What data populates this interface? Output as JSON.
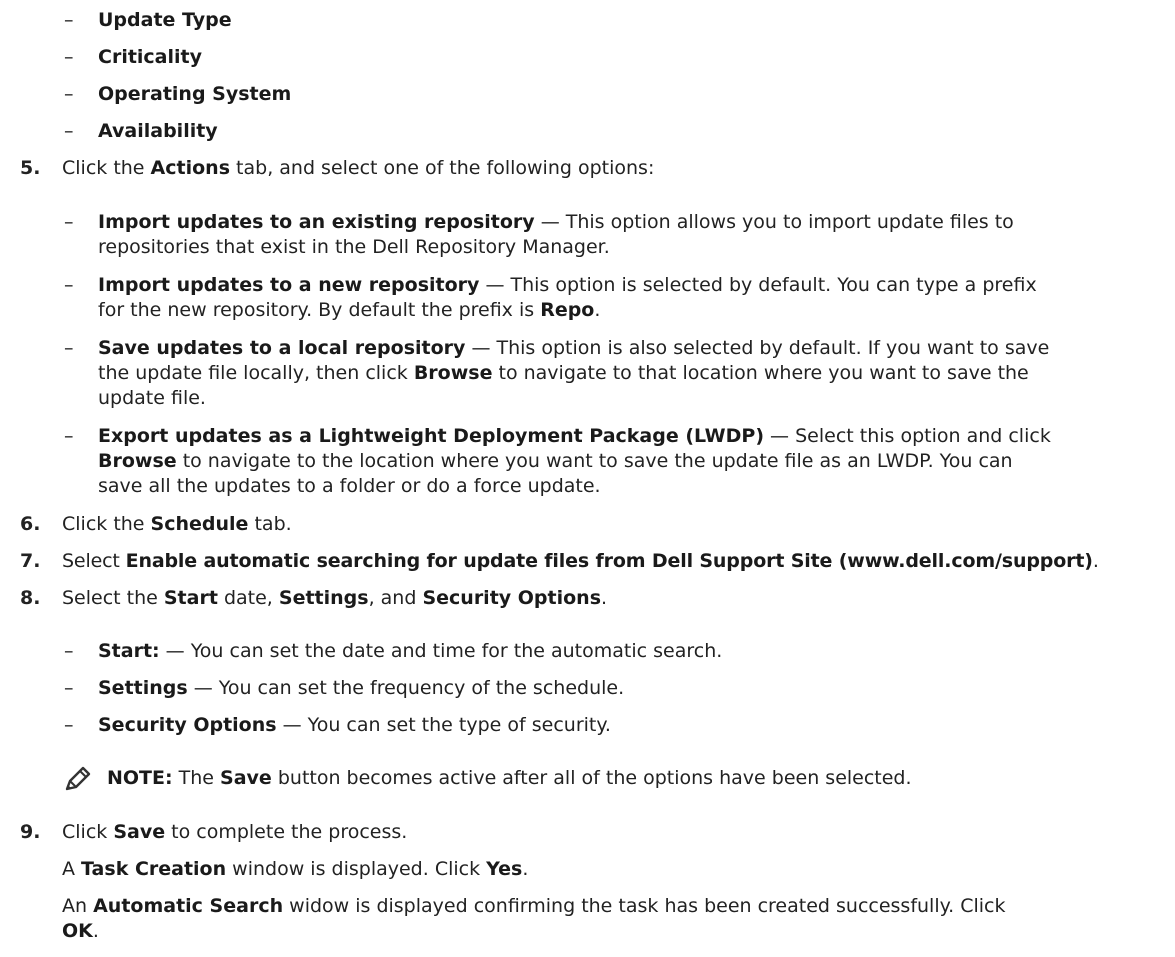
{
  "bullets_top": [
    {
      "dash": "–",
      "label": "Update Type"
    },
    {
      "dash": "–",
      "label": "Criticality"
    },
    {
      "dash": "–",
      "label": "Operating System"
    },
    {
      "dash": "–",
      "label": "Availability"
    }
  ],
  "step5": {
    "num": "5.",
    "pre": "Click the ",
    "bold": "Actions",
    "post": " tab, and select one of the following options:"
  },
  "actions": [
    {
      "dash": "–",
      "bold": "Import updates to an existing repository",
      "lines": [
        " — This option allows you to import update files to",
        "repositories that exist in the Dell Repository Manager."
      ]
    },
    {
      "dash": "–",
      "bold": "Import updates to a new repository",
      "line1": " — This option is selected by default. You can type a prefix",
      "line2_pre": "for the new repository. By default the prefix is ",
      "line2_bold": "Repo",
      "line2_post": "."
    },
    {
      "dash": "–",
      "bold": "Save updates to a local repository",
      "line1": " — This option is also selected by default. If you want to save",
      "line2_pre": "the update file locally, then click ",
      "line2_bold": "Browse",
      "line2_post": " to navigate to that location where you want to save the",
      "line3": "update file."
    },
    {
      "dash": "–",
      "bold": "Export updates as a Lightweight Deployment Package (LWDP)",
      "line1": " — Select this option and click",
      "line2_bold": "Browse",
      "line2_post": " to navigate to the location where you want to save the update file as an LWDP. You can",
      "line3": "save all the updates to a folder or do a force update."
    }
  ],
  "step6": {
    "num": "6.",
    "pre": "Click the ",
    "bold": "Schedule",
    "post": " tab."
  },
  "step7": {
    "num": "7.",
    "pre": "Select ",
    "bold": "Enable automatic searching for update files from Dell Support Site (www.dell.com/support)",
    "post": "."
  },
  "step8": {
    "num": "8.",
    "pre": "Select the ",
    "b1": "Start",
    "m1": " date, ",
    "b2": "Settings",
    "m2": ", and ",
    "b3": "Security Options",
    "post": "."
  },
  "schedule_opts": [
    {
      "dash": "–",
      "bold": "Start:",
      "text": " — You can set the date and time for the automatic search."
    },
    {
      "dash": "–",
      "bold": "Settings",
      "text": " — You can set the frequency of the schedule."
    },
    {
      "dash": "–",
      "bold": "Security Options",
      "text": " — You can set the type of security."
    }
  ],
  "note": {
    "icon": "pencil-note-icon",
    "label": "NOTE:",
    "pre": " The ",
    "bold": "Save",
    "post": " button becomes active after all of the options have been selected."
  },
  "step9": {
    "num": "9.",
    "pre": "Click ",
    "bold": "Save",
    "post": " to complete the process."
  },
  "after1": {
    "pre": "A ",
    "b1": "Task Creation",
    "mid": " window is displayed. Click ",
    "b2": "Yes",
    "post": "."
  },
  "after2": {
    "pre": "An ",
    "b1": "Automatic Search",
    "mid": " widow is displayed confirming the task has been created successfully. Click",
    "b2": "OK",
    "post": "."
  },
  "colors": {
    "text": "#222222",
    "icon": "#333333"
  }
}
